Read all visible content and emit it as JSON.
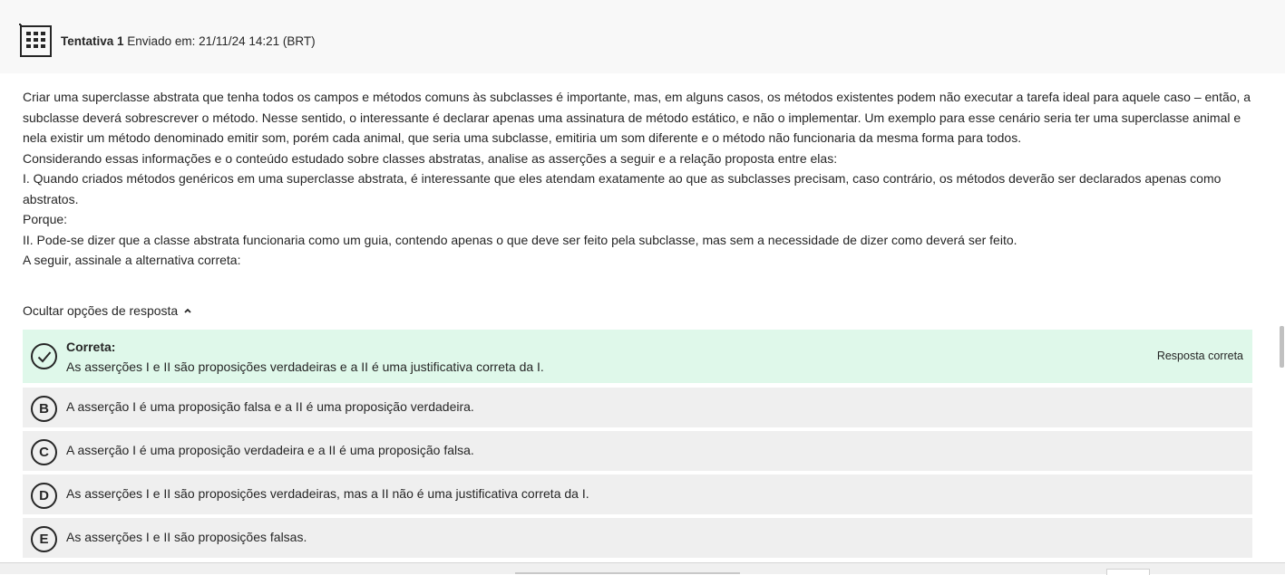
{
  "header": {
    "icon": "document-grid-icon",
    "attempt_label": "Tentativa 1",
    "submitted_text": "Enviado em: 21/11/24 14:21 (BRT)"
  },
  "question": {
    "paragraphs": [
      "Criar uma superclasse abstrata que tenha todos os campos e métodos comuns às subclasses é importante, mas, em alguns casos, os métodos existentes podem não executar a tarefa ideal para aquele caso – então, a subclasse deverá sobrescrever o método. Nesse sentido, o interessante é declarar apenas uma assinatura de método estático, e não o implementar. Um exemplo para esse cenário seria ter uma superclasse animal e nela existir um método denominado emitir som, porém cada animal, que seria uma subclasse, emitiria um som diferente e o método não funcionaria da mesma forma para todos.",
      "Considerando essas informações e o conteúdo estudado sobre classes abstratas, analise as asserções a seguir e a relação proposta entre elas:",
      "I. Quando criados métodos genéricos em uma superclasse abstrata, é interessante que eles atendam exatamente ao que as subclasses precisam, caso contrário, os métodos deverão ser declarados apenas como abstratos.",
      "Porque:",
      "II. Pode-se dizer que a classe abstrata funcionaria como um guia, contendo apenas o que deve ser feito pela subclasse, mas sem a necessidade de dizer como deverá ser feito.",
      "A seguir, assinale a alternativa correta:"
    ]
  },
  "toggle": {
    "label": "Ocultar opções de resposta",
    "icon": "chevron-up-icon"
  },
  "correct_option": {
    "icon": "check-circle-icon",
    "title": "Correta:",
    "text": "As asserções I e II são proposições verdadeiras e a II é uma justificativa correta da I.",
    "tag": "Resposta correta",
    "color": "#dff8ea"
  },
  "options": [
    {
      "letter": "B",
      "text": "A asserção I é uma proposição falsa e a II é uma proposição verdadeira."
    },
    {
      "letter": "C",
      "text": "A asserção I é uma proposição verdadeira e a II é uma proposição falsa."
    },
    {
      "letter": "D",
      "text": "As asserções I e II são proposições verdadeiras, mas a II não é uma justificativa correta da I."
    },
    {
      "letter": "E",
      "text": "As asserções I e II são proposições falsas."
    }
  ]
}
